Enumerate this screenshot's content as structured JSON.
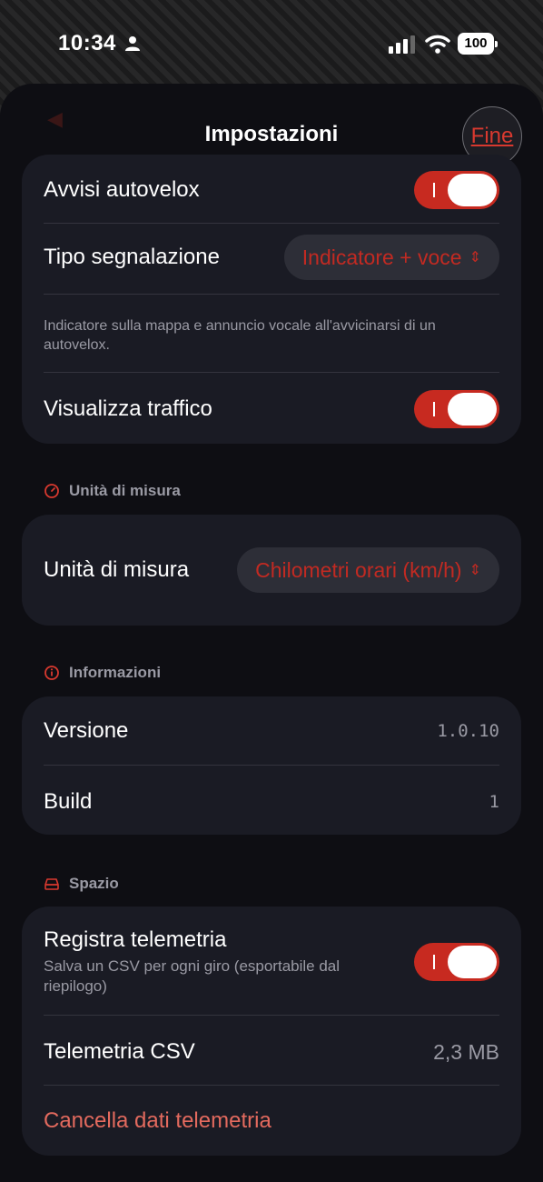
{
  "status_bar": {
    "time": "10:34",
    "battery": "100"
  },
  "nav": {
    "title": "Impostazioni",
    "done_label": "Fine"
  },
  "alerts_card": {
    "speedcam_alerts": {
      "label": "Avvisi autovelox",
      "on": true
    },
    "signal_type": {
      "label": "Tipo segnalazione",
      "value": "Indicatore + voce"
    },
    "hint": "Indicatore sulla mappa e annuncio vocale all'avvicinarsi di un autovelox.",
    "traffic": {
      "label": "Visualizza traffico",
      "on": true
    }
  },
  "units_section": {
    "header": "Unità di misura",
    "row": {
      "label": "Unità di misura",
      "value": "Chilometri orari (km/h)"
    }
  },
  "info_section": {
    "header": "Informazioni",
    "version": {
      "label": "Versione",
      "value": "1.0.10"
    },
    "build": {
      "label": "Build",
      "value": "1"
    }
  },
  "storage_section": {
    "header": "Spazio",
    "telemetry": {
      "label": "Registra telemetria",
      "subtitle": "Salva un CSV per ogni giro (esportabile dal riepilogo)",
      "on": true
    },
    "csv": {
      "label": "Telemetria CSV",
      "value": "2,3 MB"
    },
    "clear_label": "Cancella dati telemetria"
  },
  "colors": {
    "accent": "#c72a20",
    "card": "#1a1b24",
    "background": "#0e0e13",
    "danger": "#e36a5e"
  },
  "icons": [
    "person-icon",
    "signal-icon",
    "wifi-icon",
    "gauge-icon",
    "info-icon",
    "drive-icon",
    "chevron-updown-icon"
  ]
}
